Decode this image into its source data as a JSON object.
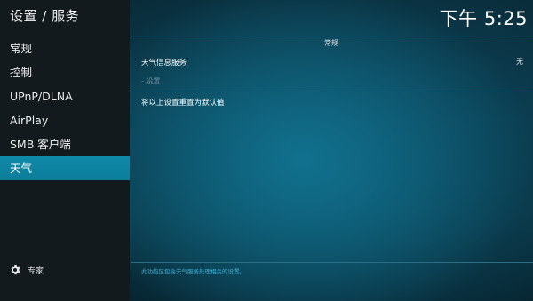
{
  "header": {
    "title": "设置 / 服务",
    "clock": "下午 5:25"
  },
  "sidebar": {
    "items": [
      {
        "label": "常规"
      },
      {
        "label": "控制"
      },
      {
        "label": "UPnP/DLNA"
      },
      {
        "label": "AirPlay"
      },
      {
        "label": "SMB 客户端"
      },
      {
        "label": "天气",
        "active": true
      }
    ],
    "settings_level": {
      "label": "专家",
      "icon": "gear-icon"
    }
  },
  "main": {
    "section_title": "常规",
    "settings": [
      {
        "label": "天气信息服务",
        "value": "无"
      },
      {
        "label": "- 设置"
      },
      {
        "label": "将以上设置重置为默认值"
      }
    ],
    "hint": "此功能区包含天气服务处理相关的设置。"
  },
  "colors": {
    "accent": "#0f8aa8",
    "sidebar_bg": "#131a1e",
    "hint_text": "#3fb2d6"
  }
}
